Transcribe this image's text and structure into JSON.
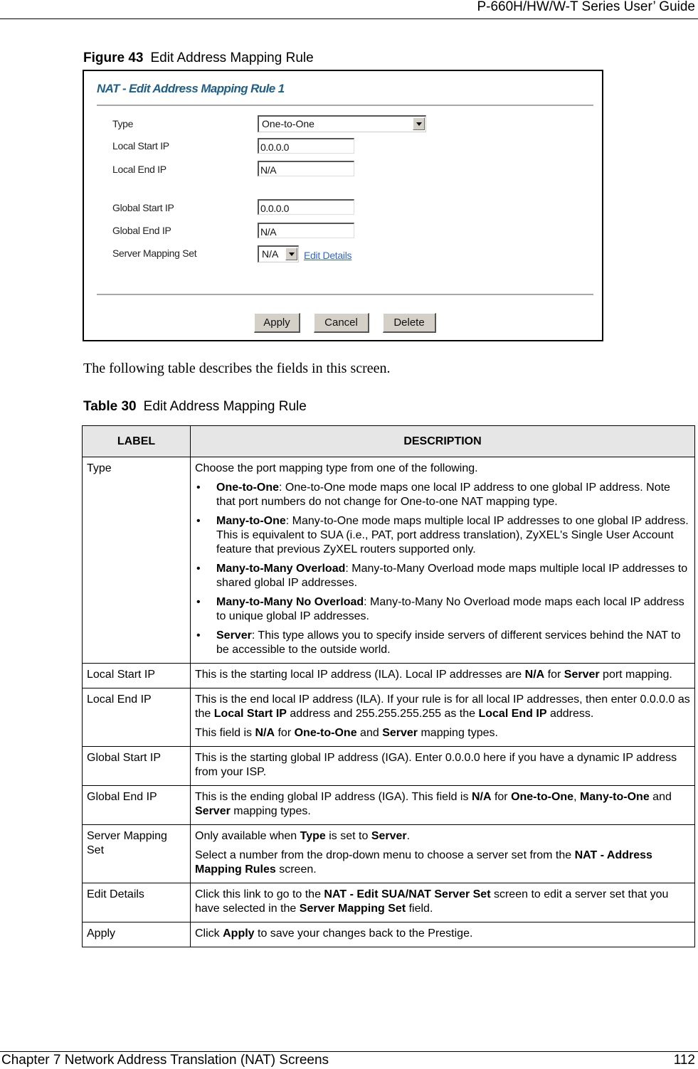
{
  "header": {
    "title": "P-660H/HW/W-T Series User’ Guide"
  },
  "figure": {
    "number": "Figure 43",
    "caption": "Edit Address Mapping Rule",
    "screen_title": "NAT - Edit Address Mapping Rule 1",
    "fields": {
      "type": {
        "label": "Type",
        "value": "One-to-One"
      },
      "local_start_ip": {
        "label": "Local Start IP",
        "value": "0.0.0.0"
      },
      "local_end_ip": {
        "label": "Local End IP",
        "value": "N/A"
      },
      "global_start_ip": {
        "label": "Global Start IP",
        "value": "0.0.0.0"
      },
      "global_end_ip": {
        "label": "Global End IP",
        "value": "N/A"
      },
      "server_mapping_set": {
        "label": "Server Mapping Set",
        "value": "N/A",
        "link": "Edit Details"
      }
    },
    "buttons": {
      "apply": "Apply",
      "cancel": "Cancel",
      "delete": "Delete"
    },
    "colors": {
      "title": "#1f5f86",
      "link": "#3366cc",
      "button_face": "#d4d0c8"
    }
  },
  "intro_text": "The following table describes the fields in this screen.",
  "table": {
    "number": "Table 30",
    "caption": "Edit Address Mapping Rule",
    "headers": [
      "LABEL",
      "DESCRIPTION"
    ],
    "rows": [
      {
        "label": "Type",
        "intro": "Choose the port mapping type from one of the following.",
        "bullets": [
          {
            "term": "One-to-One",
            "text": ": One-to-One mode maps one local IP address to one global IP address. Note that port numbers do not change for One-to-one NAT mapping type."
          },
          {
            "term": "Many-to-One",
            "text": ": Many-to-One mode maps multiple local IP addresses to one global IP address. This is equivalent to SUA (i.e., PAT, port address translation), ZyXEL's Single User Account feature that previous ZyXEL routers supported only."
          },
          {
            "term": "Many-to-Many Overload",
            "text": ": Many-to-Many Overload mode maps multiple local IP addresses to shared global IP addresses."
          },
          {
            "term": "Many-to-Many No Overload",
            "text": ": Many-to-Many No Overload mode maps each local IP address to unique global IP addresses."
          },
          {
            "term": "Server",
            "text": ": This type allows you to specify inside servers of different services behind the NAT to be accessible to the outside world."
          }
        ]
      },
      {
        "label": "Local Start IP",
        "p1": [
          "This is the starting local IP address (ILA). Local IP addresses are ",
          "N/A",
          " for ",
          "Server",
          " port mapping."
        ]
      },
      {
        "label": "Local End IP",
        "p1": [
          "This is the end local IP address (ILA). If your rule is for all local IP addresses, then enter 0.0.0.0 as the ",
          "Local Start IP",
          " address and 255.255.255.255 as the ",
          "Local End IP",
          " address."
        ],
        "p2": [
          "This field is ",
          "N/A",
          " for ",
          "One-to-One",
          " and ",
          "Server",
          " mapping types."
        ]
      },
      {
        "label": "Global Start IP",
        "p1": [
          "This is the starting global IP address (IGA). Enter 0.0.0.0 here if you have a dynamic IP address from your ISP."
        ]
      },
      {
        "label": "Global End IP",
        "p1": [
          "This is the ending global IP address (IGA). This field is ",
          "N/A",
          " for ",
          "One-to-One",
          ", ",
          "Many-to-One",
          " and ",
          "Server",
          " mapping types."
        ]
      },
      {
        "label": "Server Mapping Set",
        "p1": [
          "Only available when ",
          "Type",
          " is set to ",
          "Server",
          "."
        ],
        "p2": [
          "Select a number from the drop-down menu to choose a server set from the ",
          "NAT - Address Mapping Rules",
          " screen."
        ]
      },
      {
        "label": "Edit Details",
        "p1": [
          "Click this link to go to the ",
          "NAT - Edit SUA/NAT Server Set",
          " screen to edit a server set that you have selected in the ",
          "Server Mapping Set",
          " field."
        ]
      },
      {
        "label": "Apply",
        "p1": [
          "Click ",
          "Apply",
          " to save your changes back to the Prestige."
        ]
      }
    ]
  },
  "footer": {
    "chapter": "Chapter 7 Network Address Translation (NAT) Screens",
    "page": "112"
  }
}
